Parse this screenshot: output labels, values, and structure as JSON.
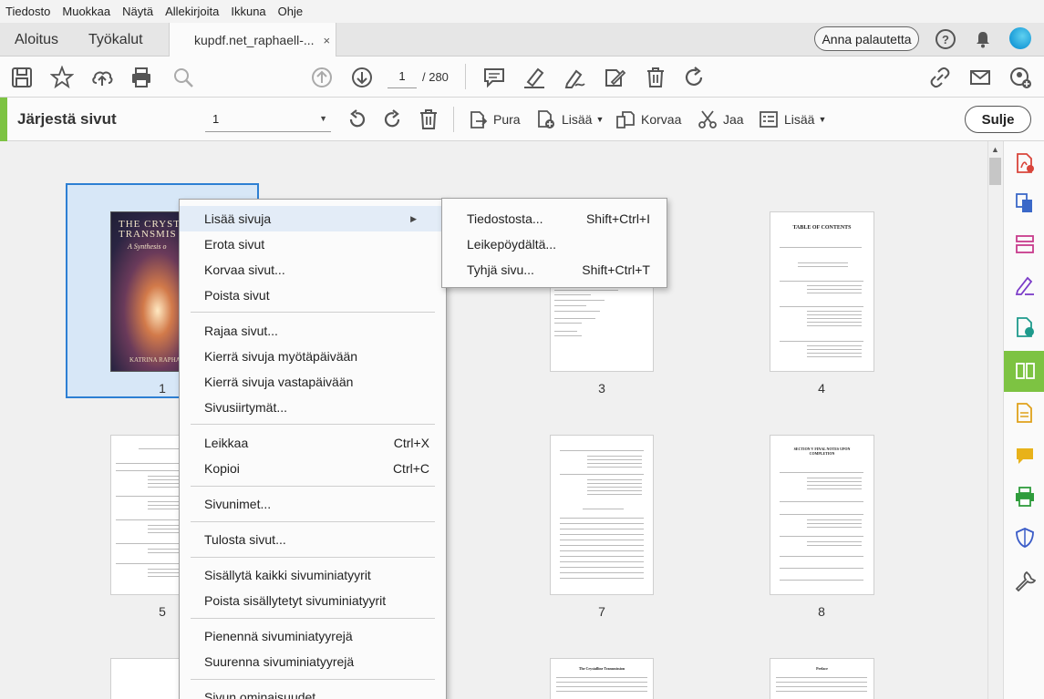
{
  "menubar": [
    "Tiedosto",
    "Muokkaa",
    "Näytä",
    "Allekirjoita",
    "Ikkuna",
    "Ohje"
  ],
  "tabs": {
    "home": "Aloitus",
    "tools": "Työkalut",
    "document": "kupdf.net_raphaell-...",
    "close_symbol": "×"
  },
  "header": {
    "feedback": "Anna palautetta",
    "help_symbol": "?"
  },
  "toolbar": {
    "page_current": "1",
    "page_total": "/ 280"
  },
  "organize": {
    "title": "Järjestä sivut",
    "page_select": "1",
    "extract": "Pura",
    "insert": "Lisää",
    "replace": "Korvaa",
    "split": "Jaa",
    "more": "Lisää",
    "close": "Sulje"
  },
  "thumbnails": {
    "page_numbers": [
      "1",
      "3",
      "4",
      "5",
      "7",
      "8"
    ],
    "cover_title": "THE CRYSTAL TRANSMIS",
    "cover_subtitle": "A Synthesis o",
    "cover_author": "KATRINA RAPHA",
    "toc_title": "TABLE OF CONTENTS",
    "p8_heading": "SECTION V FINAL NOTES UPON COMPLETION",
    "p11_heading": "The Crystalline Transmission",
    "p12_heading": "Preface"
  },
  "context_menu": {
    "items": [
      {
        "label": "Lisää sivuja",
        "shortcut": ""
      },
      {
        "label": "Erota sivut",
        "shortcut": ""
      },
      {
        "label": "Korvaa sivut...",
        "shortcut": ""
      },
      {
        "label": "Poista sivut",
        "shortcut": ""
      },
      {
        "label": "Rajaa sivut...",
        "shortcut": ""
      },
      {
        "label": "Kierrä sivuja myötäpäivään",
        "shortcut": ""
      },
      {
        "label": "Kierrä sivuja vastapäivään",
        "shortcut": ""
      },
      {
        "label": "Sivusiirtymät...",
        "shortcut": ""
      },
      {
        "label": "Leikkaa",
        "shortcut": "Ctrl+X"
      },
      {
        "label": "Kopioi",
        "shortcut": "Ctrl+C"
      },
      {
        "label": "Sivunimet...",
        "shortcut": ""
      },
      {
        "label": "Tulosta sivut...",
        "shortcut": ""
      },
      {
        "label": "Sisällytä kaikki sivuminiatyyrit",
        "shortcut": ""
      },
      {
        "label": "Poista sisällytetyt sivuminiatyyrit",
        "shortcut": ""
      },
      {
        "label": "Pienennä sivuminiatyyrejä",
        "shortcut": ""
      },
      {
        "label": "Suurenna sivuminiatyyrejä",
        "shortcut": ""
      },
      {
        "label": "Sivun ominaisuudet...",
        "shortcut": ""
      }
    ]
  },
  "submenu": {
    "items": [
      {
        "label": "Tiedostosta...",
        "shortcut": "Shift+Ctrl+I"
      },
      {
        "label": "Leikepöydältä...",
        "shortcut": ""
      },
      {
        "label": "Tyhjä sivu...",
        "shortcut": "Shift+Ctrl+T"
      }
    ]
  },
  "colors": {
    "accent": "#7dc342",
    "selection": "#2d7fd3",
    "menu_highlight": "#e3ecf7"
  }
}
